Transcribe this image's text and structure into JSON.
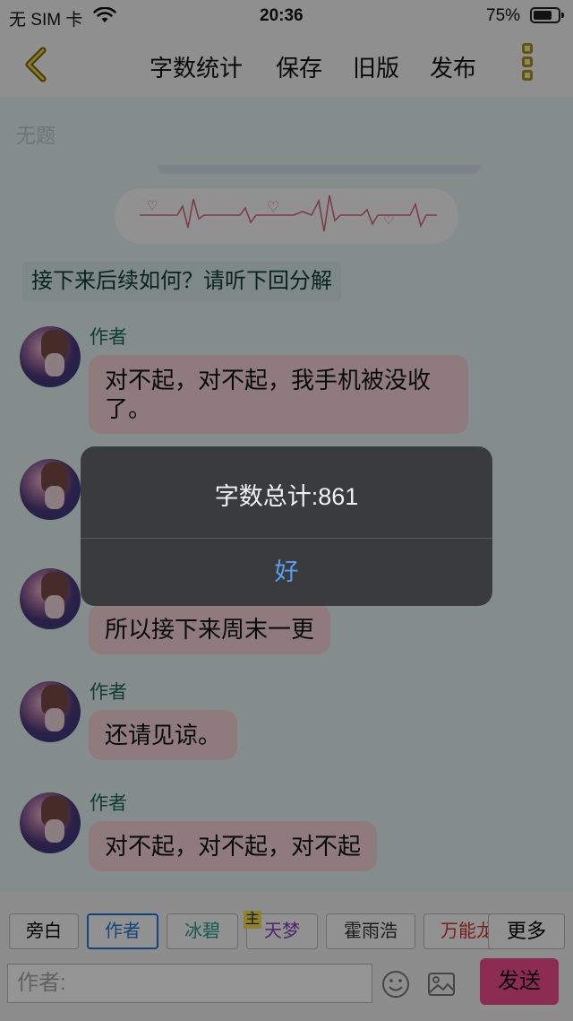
{
  "status_bar": {
    "carrier": "无 SIM 卡",
    "time": "20:36",
    "battery_percent": "75%",
    "battery_level": 0.75
  },
  "nav": {
    "items": [
      "字数统计",
      "保存",
      "旧版",
      "发布"
    ]
  },
  "document": {
    "title_placeholder": "无题",
    "narration": "接下来后续如何？请听下回分解"
  },
  "messages": [
    {
      "author": "作者",
      "text": "对不起，对不起，我手机被没收了。"
    },
    {
      "author": "作者",
      "text": ""
    },
    {
      "author": "作者",
      "text": "所以接下来周末一更"
    },
    {
      "author": "作者",
      "text": "还请见谅。"
    },
    {
      "author": "作者",
      "text": "对不起，对不起，对不起"
    }
  ],
  "roles": [
    {
      "label": "旁白",
      "color": "#111111",
      "selected": false
    },
    {
      "label": "作者",
      "color": "#1c79d8",
      "selected": true
    },
    {
      "label": "冰碧",
      "color": "#1f9e8c",
      "selected": false
    },
    {
      "label": "天梦",
      "color": "#8a3fb8",
      "selected": false,
      "mark": "主"
    },
    {
      "label": "霍雨浩",
      "color": "#333333",
      "selected": false
    },
    {
      "label": "万能龙",
      "color": "#d4332c",
      "selected": false
    }
  ],
  "more_button": "更多",
  "input": {
    "placeholder": "作者:"
  },
  "send_button": "发送",
  "icons": [
    "back-chevron-icon",
    "more-vertical-icon",
    "emoji-icon",
    "image-icon",
    "wifi-icon",
    "battery-icon"
  ],
  "alert": {
    "title": "字数总计:861",
    "ok": "好"
  }
}
